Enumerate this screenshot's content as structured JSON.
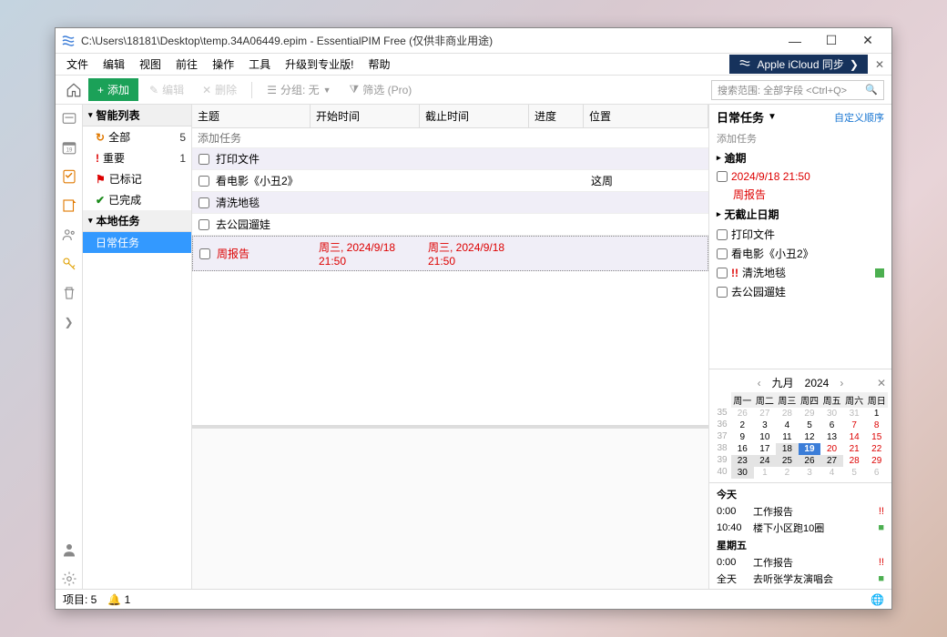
{
  "window": {
    "title": "C:\\Users\\18181\\Desktop\\temp.34A06449.epim - EssentialPIM Free (仅供非商业用途)"
  },
  "menus": [
    "文件",
    "编辑",
    "视图",
    "前往",
    "操作",
    "工具",
    "升级到专业版!",
    "帮助"
  ],
  "icloud": {
    "label": "Apple iCloud 同步"
  },
  "toolbar": {
    "add": "添加",
    "edit": "编辑",
    "delete": "删除",
    "group": "分组: 无",
    "filter": "筛选 (Pro)",
    "search_placeholder": "搜索范围: 全部字段  <Ctrl+Q>"
  },
  "tree": {
    "group1": "智能列表",
    "items1": [
      {
        "label": "全部",
        "count": "5",
        "icon": "refresh",
        "color": "#e07900"
      },
      {
        "label": "重要",
        "count": "1",
        "icon": "bang",
        "color": "#d00"
      },
      {
        "label": "已标记",
        "count": "",
        "icon": "flag",
        "color": "#d00"
      },
      {
        "label": "已完成",
        "count": "",
        "icon": "check",
        "color": "#1a8a1a"
      }
    ],
    "group2": "本地任务",
    "items2": [
      {
        "label": "日常任务",
        "selected": true
      }
    ]
  },
  "task_columns": {
    "subject": "主题",
    "start": "开始时间",
    "end": "截止时间",
    "progress": "进度",
    "location": "位置"
  },
  "add_task_placeholder": "添加任务",
  "tasks": [
    {
      "subject": "打印文件",
      "start": "",
      "end": "",
      "progress": "",
      "location": "",
      "alt": true
    },
    {
      "subject": "看电影《小丑2》",
      "start": "",
      "end": "",
      "progress": "",
      "location": "这周",
      "alt": false
    },
    {
      "subject": "清洗地毯",
      "start": "",
      "end": "",
      "progress": "",
      "location": "",
      "alt": true
    },
    {
      "subject": "去公园遛娃",
      "start": "",
      "end": "",
      "progress": "",
      "location": "",
      "alt": false
    },
    {
      "subject": "周报告",
      "start": "周三, 2024/9/18 21:50",
      "end": "周三, 2024/9/18 21:50",
      "progress": "",
      "location": "",
      "alt": true,
      "overdue": true,
      "selected": true
    }
  ],
  "right": {
    "title": "日常任务",
    "custom_order": "自定义顺序",
    "add": "添加任务",
    "group_overdue": "逾期",
    "overdue_items": [
      {
        "due": "2024/9/18 21:50",
        "name": "周报告"
      }
    ],
    "group_nodate": "无截止日期",
    "nodate_items": [
      {
        "name": "打印文件"
      },
      {
        "name": "看电影《小丑2》"
      },
      {
        "name": "清洗地毯",
        "priority": true,
        "swatch": "#4caf50"
      },
      {
        "name": "去公园遛娃"
      }
    ]
  },
  "calendar": {
    "month": "九月",
    "year": "2024",
    "dow": [
      "周一",
      "周二",
      "周三",
      "周四",
      "周五",
      "周六",
      "周日"
    ],
    "weeks": [
      {
        "wk": "35",
        "days": [
          {
            "n": "26",
            "g": 1
          },
          {
            "n": "27",
            "g": 1
          },
          {
            "n": "28",
            "g": 1
          },
          {
            "n": "29",
            "g": 1
          },
          {
            "n": "30",
            "g": 1
          },
          {
            "n": "31",
            "g": 1
          },
          {
            "n": "1"
          }
        ]
      },
      {
        "wk": "36",
        "days": [
          {
            "n": "2"
          },
          {
            "n": "3"
          },
          {
            "n": "4"
          },
          {
            "n": "5"
          },
          {
            "n": "6"
          },
          {
            "n": "7",
            "r": 1
          },
          {
            "n": "8",
            "r": 1
          }
        ]
      },
      {
        "wk": "37",
        "days": [
          {
            "n": "9"
          },
          {
            "n": "10"
          },
          {
            "n": "11"
          },
          {
            "n": "12"
          },
          {
            "n": "13"
          },
          {
            "n": "14",
            "r": 1
          },
          {
            "n": "15",
            "r": 1
          }
        ]
      },
      {
        "wk": "38",
        "days": [
          {
            "n": "16"
          },
          {
            "n": "17"
          },
          {
            "n": "18",
            "b": 1
          },
          {
            "n": "19",
            "t": 1
          },
          {
            "n": "20",
            "r": 1
          },
          {
            "n": "21",
            "r": 1
          },
          {
            "n": "22",
            "r": 1
          }
        ]
      },
      {
        "wk": "39",
        "days": [
          {
            "n": "23",
            "b": 1
          },
          {
            "n": "24",
            "b": 1
          },
          {
            "n": "25",
            "b": 1
          },
          {
            "n": "26",
            "b": 1
          },
          {
            "n": "27",
            "b": 1
          },
          {
            "n": "28",
            "r": 1
          },
          {
            "n": "29",
            "r": 1
          }
        ]
      },
      {
        "wk": "40",
        "days": [
          {
            "n": "30",
            "b": 1
          },
          {
            "n": "1",
            "g": 1
          },
          {
            "n": "2",
            "g": 1
          },
          {
            "n": "3",
            "g": 1
          },
          {
            "n": "4",
            "g": 1
          },
          {
            "n": "5",
            "g": 1
          },
          {
            "n": "6",
            "g": 1
          }
        ]
      }
    ]
  },
  "agenda": {
    "today_label": "今天",
    "today": [
      {
        "time": "0:00",
        "text": "工作报告",
        "mark": "!!",
        "mc": "#d00"
      },
      {
        "time": "10:40",
        "text": "楼下小区跑10圈",
        "mark": "■",
        "mc": "#4caf50"
      }
    ],
    "friday_label": "星期五",
    "friday": [
      {
        "time": "0:00",
        "text": "工作报告",
        "mark": "!!",
        "mc": "#d00"
      },
      {
        "time": "全天",
        "text": "去听张学友演唱会",
        "mark": "■",
        "mc": "#4caf50"
      }
    ]
  },
  "status": {
    "items": "项目: 5",
    "bell": "1"
  }
}
